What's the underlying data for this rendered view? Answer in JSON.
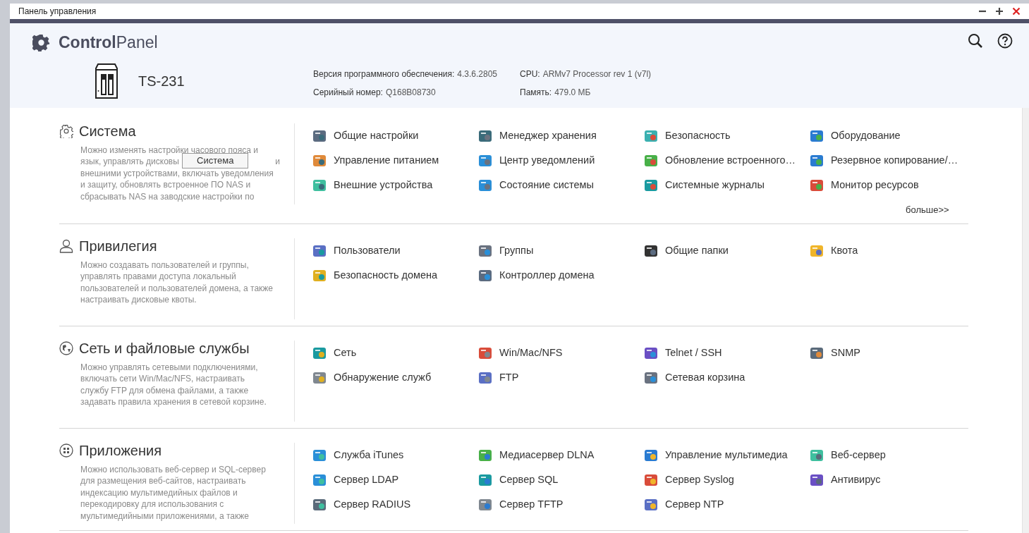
{
  "window": {
    "title": "Панель управления"
  },
  "header": {
    "logo": "**Control**Panel",
    "device": "TS-231",
    "info": [
      {
        "label": "Версия программного обеспечения:",
        "value": "4.3.6.2805"
      },
      {
        "label": "Серийный номер:",
        "value": "Q168B08730"
      },
      {
        "label": "CPU:",
        "value": "ARMv7 Processor rev 1 (v7l)"
      },
      {
        "label": "Память:",
        "value": "479.0 МБ"
      }
    ]
  },
  "sections": [
    {
      "kind": "gear",
      "title": "Система",
      "description": [
        [
          "Можно изменять настройки часового пояса и"
        ],
        [
          "язык, управлять дисковы",
          "и"
        ],
        [
          "внешними устройствами, включать уведомления"
        ],
        [
          "и защиту, обновлять встроенное ПО NAS и"
        ],
        [
          "сбрасывать NAS на заводские настройки по"
        ]
      ],
      "tooltip": "Система",
      "items": [
        {
          "label": "Общие настройки"
        },
        {
          "label": "Менеджер хранения"
        },
        {
          "label": "Безопасность"
        },
        {
          "label": "Оборудование"
        },
        {
          "label": "Управление питанием"
        },
        {
          "label": "Центр уведомлений"
        },
        {
          "label": "Обновление встроенного…"
        },
        {
          "label": "Резервное копирование/…"
        },
        {
          "label": "Внешние устройства"
        },
        {
          "label": "Состояние системы"
        },
        {
          "label": "Системные журналы"
        },
        {
          "label": "Монитор ресурсов"
        }
      ],
      "more": "больше>>"
    },
    {
      "kind": "user",
      "title": "Привилегия",
      "description": [
        [
          "Можно создавать пользователей и группы,"
        ],
        [
          "управлять правами доступа локальный"
        ],
        [
          "пользователей и пользователей домена, а также"
        ],
        [
          "настраивать дисковые квоты."
        ]
      ],
      "items": [
        {
          "label": "Пользователи"
        },
        {
          "label": "Группы"
        },
        {
          "label": "Общие папки"
        },
        {
          "label": "Квота"
        },
        {
          "label": "Безопасность домена"
        },
        {
          "label": "Контроллер домена"
        }
      ]
    },
    {
      "kind": "globe",
      "title": "Сеть и файловые службы",
      "description": [
        [
          "Можно управлять сетевыми подключениями,"
        ],
        [
          "включать сети Win/Mac/NFS, настраивать"
        ],
        [
          "службу FTP для обмена файлами, а также"
        ],
        [
          "задавать правила хранения в сетевой корзине."
        ]
      ],
      "items": [
        {
          "label": "Сеть"
        },
        {
          "label": "Win/Mac/NFS"
        },
        {
          "label": "Telnet / SSH"
        },
        {
          "label": "SNMP"
        },
        {
          "label": "Обнаружение служб"
        },
        {
          "label": "FTP"
        },
        {
          "label": "Сетевая корзина"
        }
      ]
    },
    {
      "kind": "apps",
      "title": "Приложения",
      "description": [
        [
          "Можно использовать веб-сервер и SQL-сервер"
        ],
        [
          "для размещения веб-сайтов, настраивать"
        ],
        [
          "индексацию мультимедийных файлов и"
        ],
        [
          "перекодировку для использования с"
        ],
        [
          "мультимедийными приложениями, а также"
        ]
      ],
      "items": [
        {
          "label": "Служба iTunes"
        },
        {
          "label": "Медиасервер DLNA"
        },
        {
          "label": "Управление мультимедиа"
        },
        {
          "label": "Веб-сервер"
        },
        {
          "label": "Сервер LDAP"
        },
        {
          "label": "Сервер SQL"
        },
        {
          "label": "Сервер Syslog"
        },
        {
          "label": "Антивирус"
        },
        {
          "label": "Сервер RADIUS"
        },
        {
          "label": "Сервер TFTP"
        },
        {
          "label": "Сервер NTP"
        }
      ]
    }
  ]
}
